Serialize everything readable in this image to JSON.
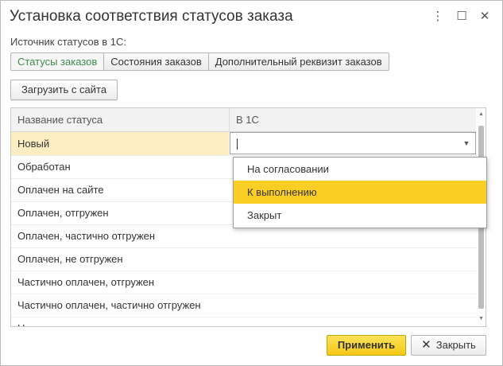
{
  "window": {
    "title": "Установка соответствия статусов заказа",
    "controls": {
      "more": "⋮",
      "maximize": "☐",
      "close": "✕"
    }
  },
  "source": {
    "label": "Источник статусов в 1С:",
    "tabs": [
      {
        "label": "Статусы заказов",
        "active": true
      },
      {
        "label": "Состояния заказов",
        "active": false
      },
      {
        "label": "Дополнительный реквизит заказов",
        "active": false
      }
    ]
  },
  "load_button": {
    "label": "Загрузить с сайта"
  },
  "table": {
    "columns": [
      "Название статуса",
      "В 1С"
    ],
    "rows": [
      {
        "name": "Новый",
        "value": ""
      },
      {
        "name": "Обработан",
        "value": ""
      },
      {
        "name": "Оплачен на сайте",
        "value": ""
      },
      {
        "name": "Оплачен, отгружен",
        "value": ""
      },
      {
        "name": "Оплачен, частично отгружен",
        "value": ""
      },
      {
        "name": "Оплачен, не отгружен",
        "value": ""
      },
      {
        "name": "Частично оплачен, отгружен",
        "value": ""
      },
      {
        "name": "Частично оплачен, частично отгружен",
        "value": ""
      },
      {
        "name": "Н...",
        "value": ""
      }
    ],
    "selected_row": 0
  },
  "dropdown": {
    "options": [
      "На согласовании",
      "К выполнению",
      "Закрыт"
    ],
    "highlighted": 1
  },
  "footer": {
    "apply_label": "Применить",
    "close_label": "Закрыть"
  },
  "colors": {
    "accent_yellow": "#fbce25",
    "selected_row": "#fbeec2",
    "active_tab_text": "#3f8a4f"
  }
}
